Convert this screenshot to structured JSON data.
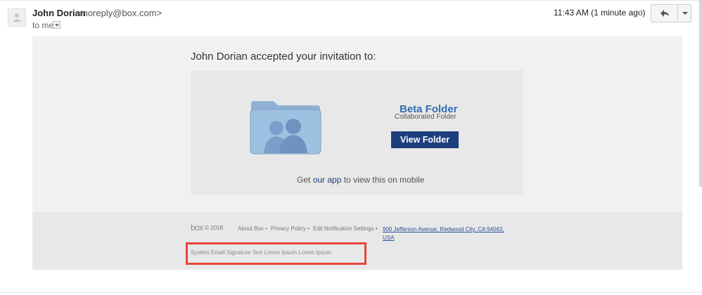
{
  "header": {
    "sender_name": "John Dorian",
    "sender_email": "<noreply@box.com>",
    "to_label": "to me",
    "timestamp": "11:43 AM (1 minute ago)",
    "star_glyph": "☆"
  },
  "email": {
    "headline": "John Dorian accepted your invitation to:",
    "folder_name": "Beta Folder",
    "folder_subtitle": "Collaborated Folder",
    "view_button": "View Folder",
    "mobile_prefix": "Get ",
    "mobile_link": "our app",
    "mobile_suffix": " to view this on mobile"
  },
  "footer": {
    "logo": "box",
    "copyright": "© 2018",
    "links": [
      "About Box •",
      "Privacy Policy •",
      "Edit Notification Settings •"
    ],
    "address": "900 Jefferson Avenue, Redwood City, CA 94063, USA",
    "signature": "System Email Signature Text Lorem Ipsum Lorem Ipsum"
  },
  "colors": {
    "accent": "#1d3e7c",
    "link": "#2f6fb1",
    "highlight": "#e8453c"
  }
}
